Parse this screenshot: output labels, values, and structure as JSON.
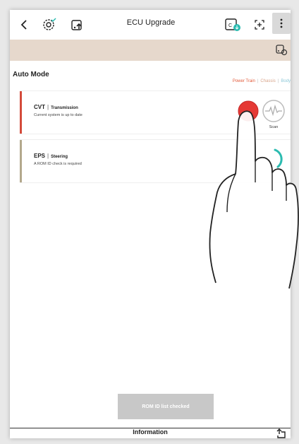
{
  "header": {
    "title": "ECU Upgrade",
    "icons": [
      "back-chevron-icon",
      "settings-check-icon",
      "vehicle-upload-icon",
      "ecu-chip-icon",
      "expand-icon",
      "more-vertical-icon"
    ]
  },
  "banner": {
    "icon": "vehicle-settings-icon"
  },
  "mode": {
    "title": "Auto Mode",
    "filters": [
      "Power Train",
      "Chassis",
      "Body"
    ],
    "separator": "|"
  },
  "cards": [
    {
      "name": "CVT",
      "category": "Transmission",
      "description": "Current system is up to date",
      "accent": "#d44a3a",
      "action": "Scan"
    },
    {
      "name": "EPS",
      "category": "Steering",
      "description": "A ROM ID check is required",
      "accent": "#b3a88c"
    }
  ],
  "rom_button": "ROM ID list checked",
  "footer": {
    "label": "Information",
    "icon": "upload-corner-icon"
  },
  "colors": {
    "accent_red": "#e53935",
    "teal": "#2bbbb0",
    "banner": "#e6d8cc",
    "button_disabled": "#c8c8c8"
  }
}
